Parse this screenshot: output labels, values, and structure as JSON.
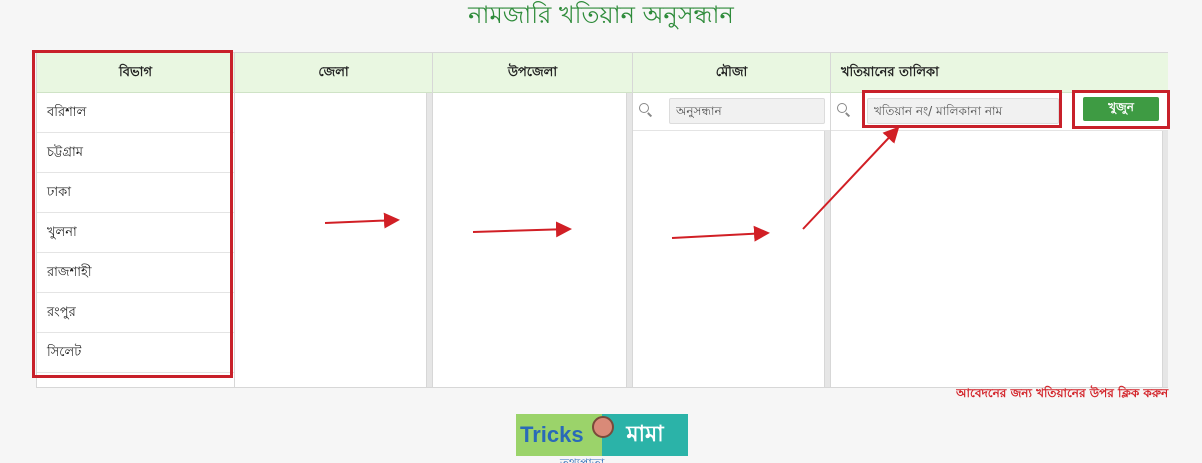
{
  "page": {
    "title": "নামজারি খতিয়ান অনুসন্ধান"
  },
  "columns": {
    "division": {
      "label": "বিভাগ",
      "items": [
        "বরিশাল",
        "চট্টগ্রাম",
        "ঢাকা",
        "খুলনা",
        "রাজশাহী",
        "রংপুর",
        "সিলেট"
      ]
    },
    "district": {
      "label": "জেলা"
    },
    "upazila": {
      "label": "উপজেলা"
    },
    "mouza": {
      "label": "মৌজা",
      "search_placeholder": "অনুসন্ধান"
    },
    "khatian": {
      "label": "খতিয়ানের তালিকা",
      "search_placeholder": "খতিয়ান নং/ মালিকানা নাম"
    }
  },
  "search_button": {
    "label": "খুজুন"
  },
  "note": {
    "text": "আবেদনের জন্য খতিয়ানের উপর ক্লিক করুন"
  },
  "logo": {
    "part1": "Tricks",
    "part2": "মামা",
    "subtitle": "তথ্যপাতা"
  },
  "colors": {
    "accent_green": "#3e9b43",
    "header_bg": "#e9f7e1",
    "highlight_red": "#c8202a",
    "title_green": "#2e8b3a"
  },
  "icons": [
    "search-icon",
    "arrow-right-icon",
    "lightbulb-icon"
  ]
}
